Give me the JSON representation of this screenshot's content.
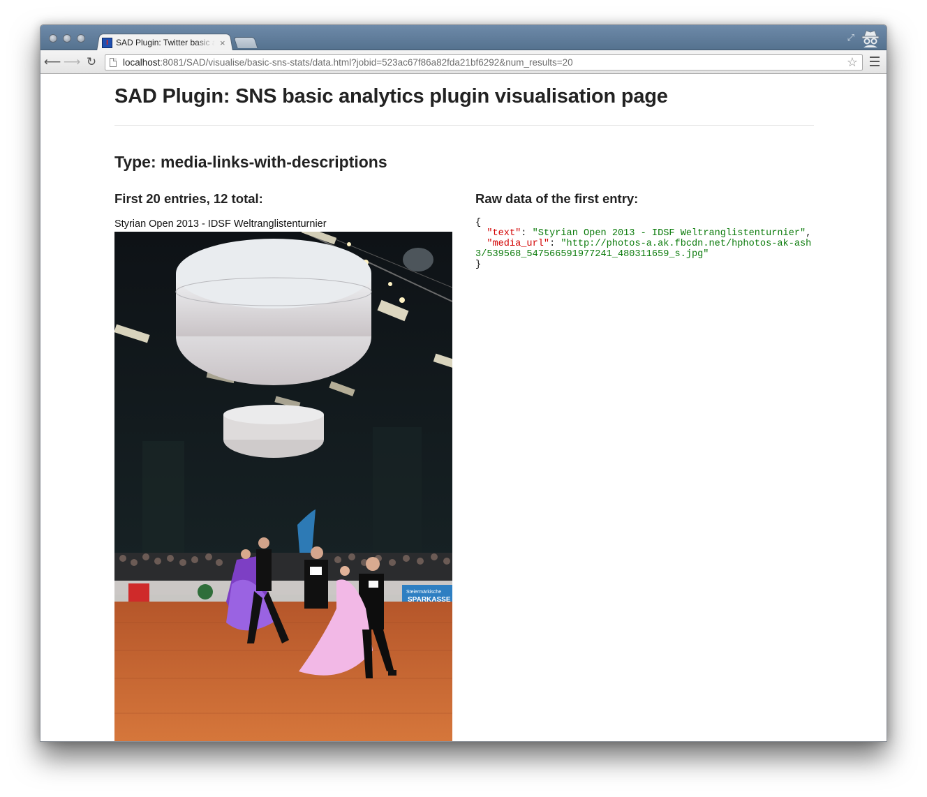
{
  "browser": {
    "tab_title": "SAD Plugin: Twitter basic analytics",
    "tab_close": "×",
    "url_host": "localhost",
    "url_rest": ":8081/SAD/visualise/basic-sns-stats/data.html?jobid=523ac67f86a82fda21bf6292&num_results=20"
  },
  "page": {
    "title": "SAD Plugin: SNS basic analytics plugin visualisation page",
    "type_heading": "Type: media-links-with-descriptions",
    "entries_heading": "First 20 entries, 12 total:",
    "raw_heading": "Raw data of the first entry:",
    "first_entry_text": "Styrian Open 2013 - IDSF Weltranglistenturnier",
    "raw": {
      "open": "{",
      "text_key": "\"text\"",
      "text_value": "\"Styrian Open 2013 - IDSF Weltranglistenturnier\"",
      "media_key": "\"media_url\"",
      "media_value": "\"http://photos-a.ak.fbcdn.net/hphotos-ak-ash3/539568_547566591977241_480311659_s.jpg\"",
      "close": "}"
    },
    "photo_banner": "Steiermärkische SPARKASSE"
  }
}
